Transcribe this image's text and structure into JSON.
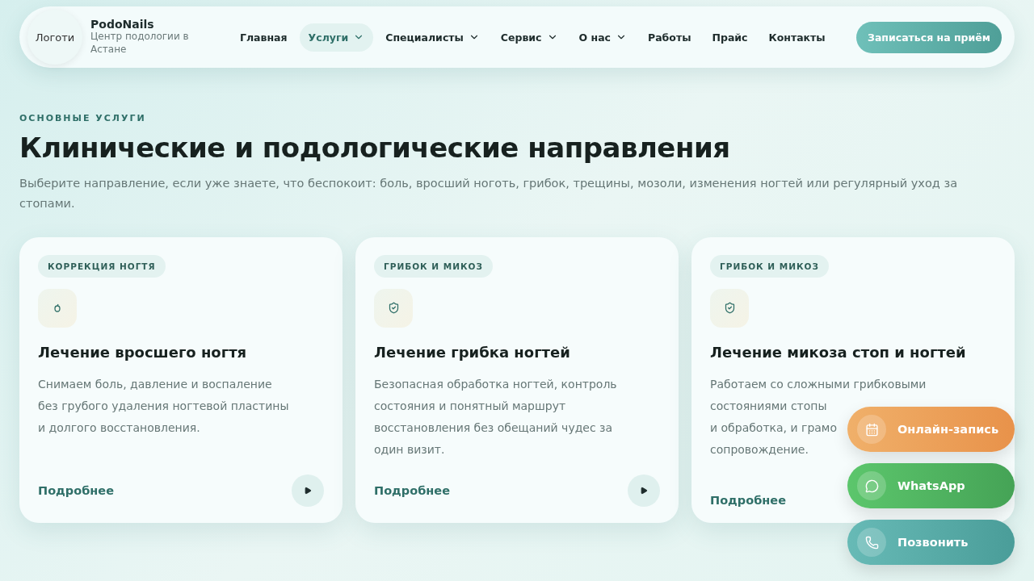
{
  "header": {
    "logo_text": "Логоти",
    "brand": "PodoNails",
    "tagline": "Центр подологии в Астане",
    "nav": [
      {
        "label": "Главная",
        "dropdown": false,
        "selected": false
      },
      {
        "label": "Услуги",
        "dropdown": true,
        "selected": true
      },
      {
        "label": "Специалисты",
        "dropdown": true,
        "selected": false
      },
      {
        "label": "Сервис",
        "dropdown": true,
        "selected": false
      },
      {
        "label": "О нас",
        "dropdown": true,
        "selected": false
      },
      {
        "label": "Работы",
        "dropdown": false,
        "selected": false
      },
      {
        "label": "Прайс",
        "dropdown": false,
        "selected": false
      },
      {
        "label": "Контакты",
        "dropdown": false,
        "selected": false
      }
    ],
    "cta": "Записаться на приём"
  },
  "section": {
    "eyebrow": "ОСНОВНЫЕ УСЛУГИ",
    "title": "Клинические и подологические направления",
    "lead": "Выберите направление, если уже знаете, что беспокоит: боль, вросший ноготь, грибок, трещины, мозоли, изменения ногтей или регулярный уход за стопами."
  },
  "cards": [
    {
      "tag": "КОРРЕКЦИЯ НОГТЯ",
      "kind": "drop",
      "title": "Лечение вросшего ногтя",
      "lines": [
        "Снимаем боль, давление и воспаление",
        "без грубого удаления ногтевой пластины",
        "и долгого восстановления."
      ],
      "link": "Подробнее",
      "arrow": true
    },
    {
      "tag": "ГРИБОК И МИКОЗ",
      "kind": "shield",
      "title": "Лечение грибка ногтей",
      "lines": [
        "Безопасная обработка ногтей, контроль",
        "состояния и понятный маршрут",
        "восстановления без обещаний чудес за",
        "один визит."
      ],
      "link": "Подробнее",
      "arrow": true
    },
    {
      "tag": "ГРИБОК И МИКОЗ",
      "kind": "shield",
      "title": "Лечение микоза стоп и ногтей",
      "lines": [
        "Работаем со сложными грибковыми",
        "состояниями стопы",
        "и обработка, и грамо",
        "сопровождение."
      ],
      "link": "Подробнее",
      "arrow": false
    }
  ],
  "floating": [
    {
      "kind": "booking",
      "label": "Онлайн-запись"
    },
    {
      "kind": "whatsapp",
      "label": "WhatsApp"
    },
    {
      "kind": "call",
      "label": "Позвонить"
    }
  ]
}
